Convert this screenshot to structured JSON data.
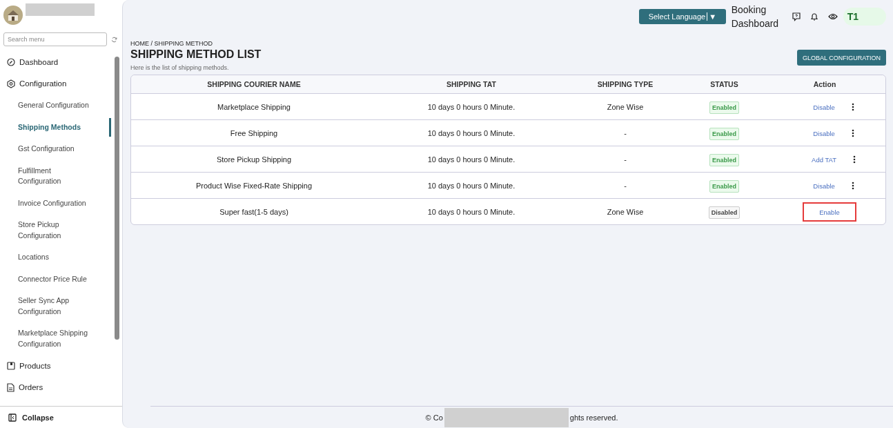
{
  "sidebar": {
    "search": {
      "placeholder": "Search menu"
    },
    "items": [
      {
        "label": "Dashboard",
        "kind": "section",
        "selected": false
      },
      {
        "label": "Configuration",
        "kind": "section",
        "selected": false
      },
      {
        "label": "General Configuration",
        "kind": "sub",
        "selected": false
      },
      {
        "label": "Shipping Methods",
        "kind": "sub",
        "selected": true
      },
      {
        "label": "Gst Configuration",
        "kind": "sub",
        "selected": false
      },
      {
        "label": "Fulfillment Configuration",
        "kind": "sub",
        "selected": false
      },
      {
        "label": "Invoice Configuration",
        "kind": "sub",
        "selected": false
      },
      {
        "label": "Store Pickup Configuration",
        "kind": "sub",
        "selected": false
      },
      {
        "label": "Locations",
        "kind": "sub",
        "selected": false
      },
      {
        "label": "Connector Price Rule",
        "kind": "sub",
        "selected": false
      },
      {
        "label": "Seller Sync App Configuration",
        "kind": "sub",
        "selected": false
      },
      {
        "label": "Marketplace Shipping Configuration",
        "kind": "sub",
        "selected": false
      },
      {
        "label": "Products",
        "kind": "section",
        "selected": false
      },
      {
        "label": "Orders",
        "kind": "section",
        "selected": false
      }
    ],
    "collapse": "Collapse"
  },
  "topbar": {
    "language": "Select Language",
    "caret": "▼",
    "booking": "Booking Dashboard",
    "user": "T1"
  },
  "breadcrumb": "HOME / SHIPPING METHOD",
  "title": "SHIPPING METHOD LIST",
  "subtitle": "Here is the list of shipping methods.",
  "global_button": "GLOBAL CONFIGURATION",
  "table": {
    "columns": [
      "SHIPPING COURIER NAME",
      "SHIPPING TAT",
      "SHIPPING TYPE",
      "STATUS",
      "Action"
    ],
    "rows": [
      {
        "name": "Marketplace Shipping",
        "tat": "10 days 0 hours 0 Minute.",
        "type": "Zone Wise",
        "status": "Enabled",
        "enabled": true,
        "action": "Disable",
        "menu": true,
        "highlighted": false
      },
      {
        "name": "Free Shipping",
        "tat": "10 days 0 hours 0 Minute.",
        "type": "-",
        "status": "Enabled",
        "enabled": true,
        "action": "Disable",
        "menu": true,
        "highlighted": false
      },
      {
        "name": "Store Pickup Shipping",
        "tat": "10 days 0 hours 0 Minute.",
        "type": "-",
        "status": "Enabled",
        "enabled": true,
        "action": "Add TAT",
        "menu": true,
        "highlighted": false
      },
      {
        "name": "Product Wise Fixed-Rate Shipping",
        "tat": "10 days 0 hours 0 Minute.",
        "type": "-",
        "status": "Enabled",
        "enabled": true,
        "action": "Disable",
        "menu": true,
        "highlighted": false
      },
      {
        "name": "Super fast(1-5 days)",
        "tat": "10 days 0 hours 0 Minute.",
        "type": "Zone Wise",
        "status": "Disabled",
        "enabled": false,
        "action": "Enable",
        "menu": false,
        "highlighted": true
      }
    ]
  },
  "footer": {
    "start": "© Co",
    "end": "ghts reserved."
  }
}
